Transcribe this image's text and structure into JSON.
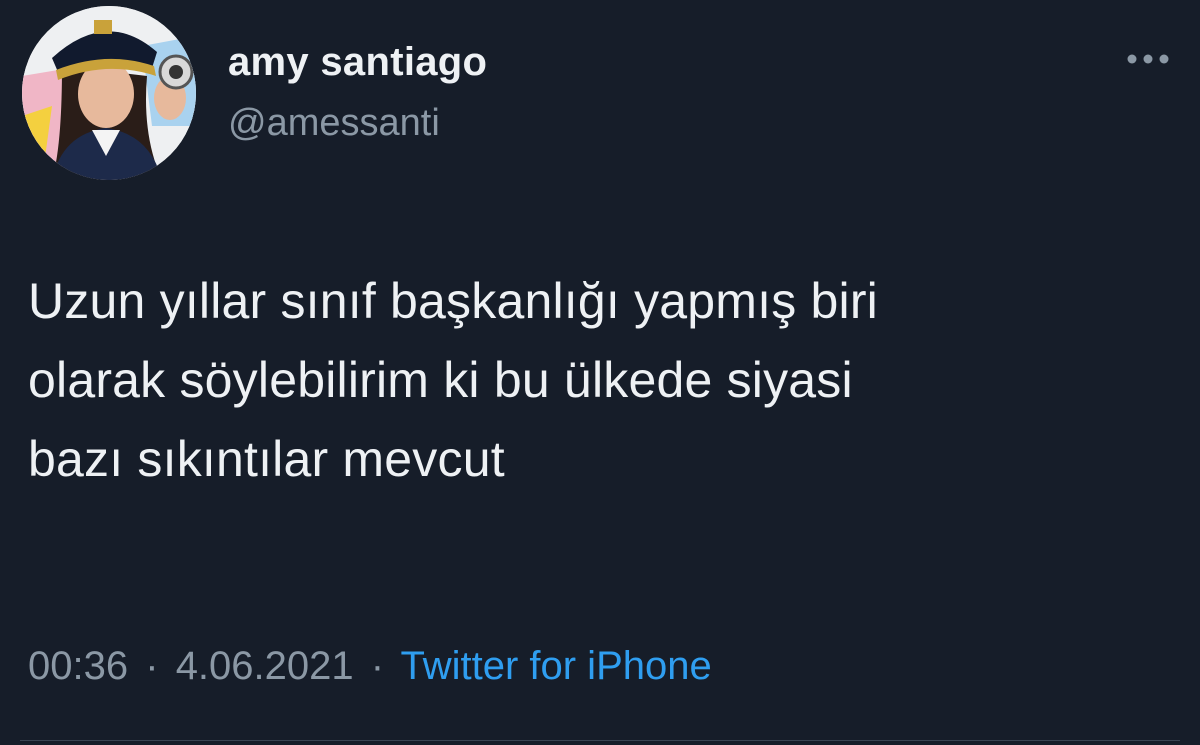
{
  "user": {
    "display_name": "amy santiago",
    "handle": "@amessanti",
    "avatar_icon": "profile-photo-police-cap"
  },
  "tweet": {
    "lines": [
      "Uzun yıllar sınıf başkanlığı yapmış biri",
      "olarak söylebilirim ki bu ülkede siyasi",
      "bazı sıkıntılar mevcut"
    ],
    "time": "00:36",
    "separator": "·",
    "date": "4.06.2021",
    "source": "Twitter for iPhone"
  },
  "colors": {
    "background": "#161d29",
    "text": "#eef1f4",
    "muted": "#8b98a5",
    "link": "#2f9ef0"
  },
  "icons": {
    "more": "more-options-icon"
  }
}
